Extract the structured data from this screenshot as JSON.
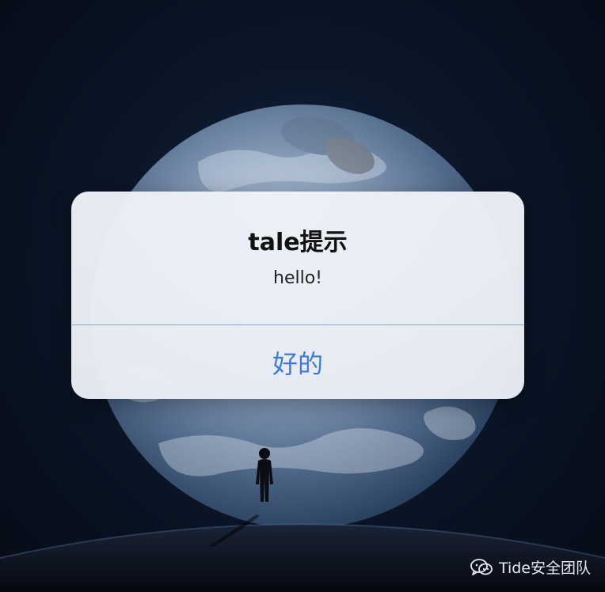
{
  "dialog": {
    "title": "tale提示",
    "message": "hello!",
    "button_label": "好的"
  },
  "watermark": {
    "label": "Tide安全团队",
    "icon": "wechat-icon"
  },
  "colors": {
    "accent": "#3f7ad6",
    "dialog_background": "#eef1f7",
    "divider": "#8ea6c9"
  }
}
